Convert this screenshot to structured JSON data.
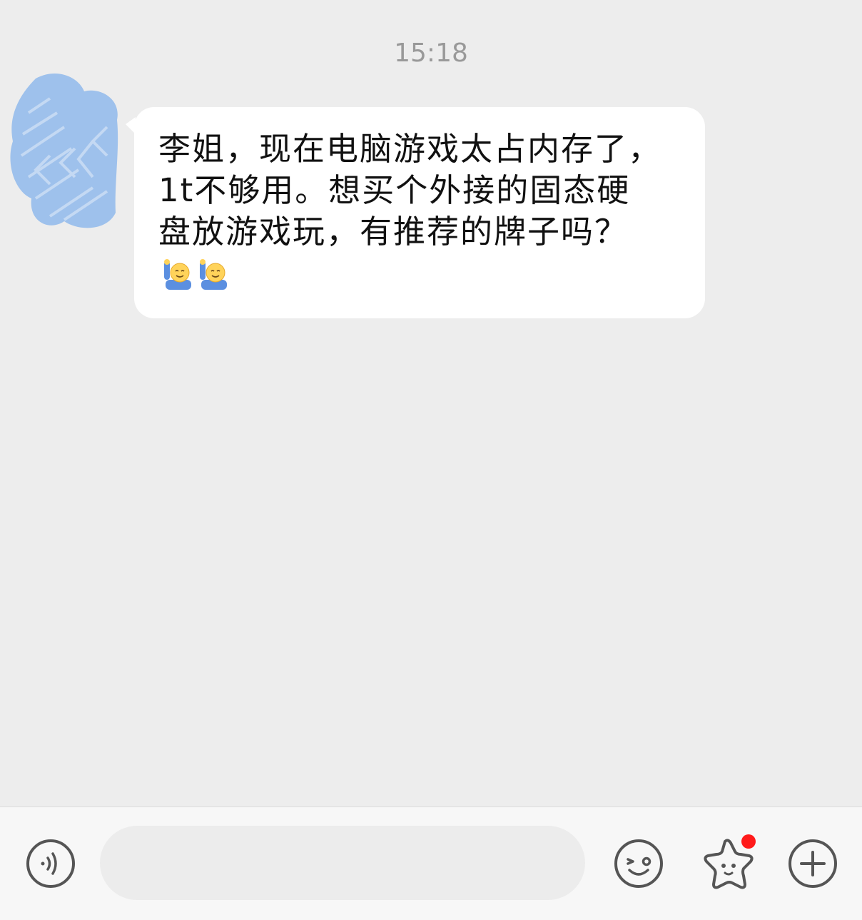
{
  "chat": {
    "timestamp": "15:18",
    "messages": [
      {
        "sender": "contact",
        "text": "李姐，现在电脑游戏太占内存了，1t不够用。想买个外接的固态硬盘放游戏玩，有推荐的牌子吗？",
        "emojis": [
          "raising-hand-emoji",
          "raising-hand-emoji"
        ]
      }
    ]
  },
  "input_bar": {
    "input_value": "",
    "icons": [
      "voice-icon",
      "emoji-icon",
      "star-sticker-icon",
      "plus-icon"
    ],
    "notification_dot_color": "#ff1a1a"
  },
  "colors": {
    "background": "#ededed",
    "bubble": "#ffffff",
    "avatar_blur": "#9ec1ec"
  }
}
